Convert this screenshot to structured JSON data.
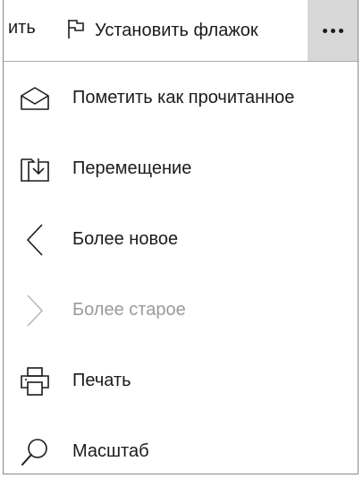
{
  "toolbar": {
    "partial_label": "ить",
    "flag_label": "Установить флажок",
    "more_label": "•••"
  },
  "menu": {
    "items": [
      {
        "label": "Пометить как прочитанное",
        "icon": "open-envelope-icon",
        "enabled": true
      },
      {
        "label": "Перемещение",
        "icon": "move-to-folder-icon",
        "enabled": true
      },
      {
        "label": "Более новое",
        "icon": "chevron-left-icon",
        "enabled": true
      },
      {
        "label": "Более старое",
        "icon": "chevron-right-icon",
        "enabled": false
      },
      {
        "label": "Печать",
        "icon": "printer-icon",
        "enabled": true
      },
      {
        "label": "Масштаб",
        "icon": "magnifier-icon",
        "enabled": true
      }
    ]
  },
  "colors": {
    "more_button_bg": "#d7d7d7",
    "text": "#1b1b1b",
    "disabled_text": "#9a9a9a"
  }
}
